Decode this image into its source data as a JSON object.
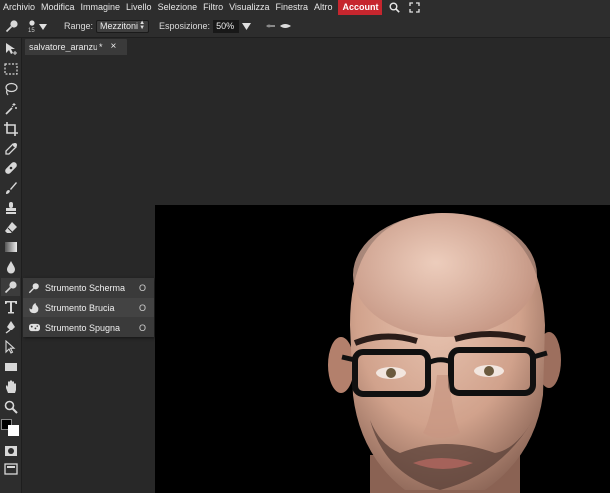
{
  "menubar": {
    "items": [
      "Archivio",
      "Modifica",
      "Immagine",
      "Livello",
      "Selezione",
      "Filtro",
      "Visualizza",
      "Finestra",
      "Altro"
    ],
    "account_label": "Account",
    "icons": [
      "search-icon",
      "fullscreen-icon"
    ]
  },
  "options": {
    "brush_size": "15",
    "range_label": "Range:",
    "range_value": "Mezzitoni",
    "exposure_label": "Esposizione:",
    "exposure_value": "50%"
  },
  "document": {
    "tab_title": "salvatore_aranzulla",
    "modified_marker": "*",
    "close_glyph": "×"
  },
  "tool_flyout": {
    "items": [
      {
        "label": "Strumento Scherma",
        "shortcut": "O",
        "icon": "dodge-tool-icon"
      },
      {
        "label": "Strumento Brucia",
        "shortcut": "O",
        "icon": "burn-tool-icon"
      },
      {
        "label": "Strumento Spugna",
        "shortcut": "O",
        "icon": "sponge-tool-icon"
      }
    ]
  },
  "toolbar": {
    "icons": [
      "move-tool-icon",
      "marquee-tool-icon",
      "lasso-tool-icon",
      "magic-wand-icon",
      "crop-tool-icon",
      "eyedropper-icon",
      "healing-brush-icon",
      "brush-tool-icon",
      "clone-stamp-icon",
      "eraser-icon",
      "gradient-icon",
      "blur-tool-icon",
      "dodge-tool-icon",
      "pen-tool-icon",
      "type-tool-icon",
      "path-select-icon",
      "rectangle-tool-icon",
      "hand-tool-icon",
      "zoom-tool-icon",
      "color-swatches-icon",
      "quick-mask-icon",
      "screen-mode-icon"
    ]
  },
  "colors": {
    "account_bg": "#c6262e",
    "ui_bg": "#2d2d2d",
    "workspace_bg": "#282828",
    "canvas_bg": "#000000"
  }
}
